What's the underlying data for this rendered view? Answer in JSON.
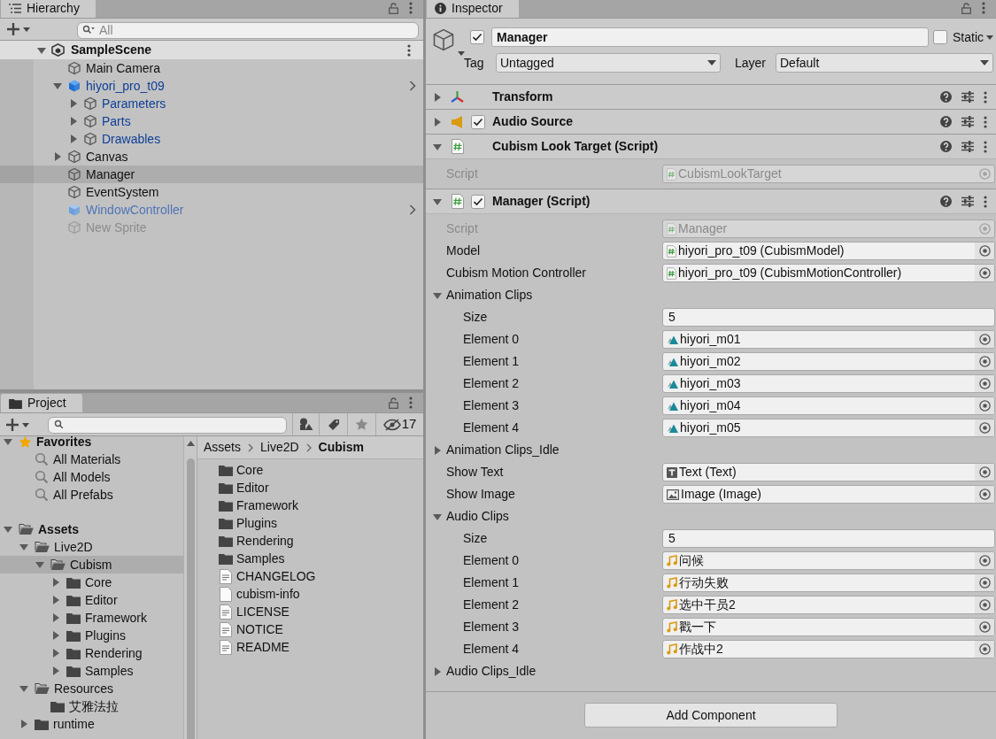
{
  "hierarchy": {
    "title": "Hierarchy",
    "search_placeholder": "All",
    "scene": {
      "name": "SampleScene",
      "expanded": true
    },
    "items": [
      {
        "name": "Main Camera",
        "kind": "object",
        "dimmed": false,
        "selected": false
      },
      {
        "name": "hiyori_pro_t09",
        "kind": "prefab",
        "dimmed": false,
        "selected": false,
        "expanded": true,
        "children": [
          {
            "name": "Parameters",
            "kind": "prefab-part",
            "dimmed": false,
            "selected": false,
            "expanded": false
          },
          {
            "name": "Parts",
            "kind": "prefab-part",
            "dimmed": false,
            "selected": false,
            "expanded": false
          },
          {
            "name": "Drawables",
            "kind": "prefab-part",
            "dimmed": false,
            "selected": false,
            "expanded": false
          }
        ]
      },
      {
        "name": "Canvas",
        "kind": "object",
        "dimmed": false,
        "selected": false,
        "expanded": false
      },
      {
        "name": "Manager",
        "kind": "object",
        "dimmed": false,
        "selected": true
      },
      {
        "name": "EventSystem",
        "kind": "object",
        "dimmed": false,
        "selected": false
      },
      {
        "name": "WindowController",
        "kind": "prefab",
        "dimmed": true,
        "selected": false
      },
      {
        "name": "New Sprite",
        "kind": "object",
        "dimmed": true,
        "selected": false
      }
    ]
  },
  "project": {
    "title": "Project",
    "hidden_count": "17",
    "favorites": {
      "label": "Favorites",
      "expanded": true,
      "items": [
        {
          "label": "All Materials"
        },
        {
          "label": "All Models"
        },
        {
          "label": "All Prefabs"
        }
      ]
    },
    "tree": [
      {
        "label": "Assets",
        "expanded": true,
        "selected": false,
        "children": [
          {
            "label": "Live2D",
            "expanded": true,
            "selected": false,
            "children": [
              {
                "label": "Cubism",
                "expanded": true,
                "selected": true,
                "children": [
                  {
                    "label": "Core",
                    "expanded": false,
                    "selected": false
                  },
                  {
                    "label": "Editor",
                    "expanded": false,
                    "selected": false
                  },
                  {
                    "label": "Framework",
                    "expanded": false,
                    "selected": false
                  },
                  {
                    "label": "Plugins",
                    "expanded": false,
                    "selected": false
                  },
                  {
                    "label": "Rendering",
                    "expanded": false,
                    "selected": false
                  },
                  {
                    "label": "Samples",
                    "expanded": false,
                    "selected": false
                  }
                ]
              }
            ]
          },
          {
            "label": "Resources",
            "expanded": true,
            "selected": false,
            "children": [
              {
                "label": "艾雅法拉",
                "selected": false
              }
            ]
          },
          {
            "label": "runtime",
            "expanded": false,
            "selected": false
          }
        ]
      }
    ],
    "breadcrumb": [
      "Assets",
      "Live2D",
      "Cubism"
    ],
    "files": [
      {
        "name": "Core",
        "kind": "folder"
      },
      {
        "name": "Editor",
        "kind": "folder"
      },
      {
        "name": "Framework",
        "kind": "folder"
      },
      {
        "name": "Plugins",
        "kind": "folder"
      },
      {
        "name": "Rendering",
        "kind": "folder"
      },
      {
        "name": "Samples",
        "kind": "folder"
      },
      {
        "name": "CHANGELOG",
        "kind": "text"
      },
      {
        "name": "cubism-info",
        "kind": "blank"
      },
      {
        "name": "LICENSE",
        "kind": "text"
      },
      {
        "name": "NOTICE",
        "kind": "text"
      },
      {
        "name": "README",
        "kind": "text"
      }
    ]
  },
  "inspector": {
    "title": "Inspector",
    "object": {
      "active": true,
      "name": "Manager",
      "static": false,
      "static_label": "Static",
      "tag_label": "Tag",
      "tag": "Untagged",
      "layer_label": "Layer",
      "layer": "Default"
    },
    "components": [
      {
        "name": "Transform",
        "kind": "transform",
        "expanded": false
      },
      {
        "name": "Audio Source",
        "kind": "audio",
        "expanded": false,
        "enabled": true
      },
      {
        "name": "Cubism Look Target (Script)",
        "kind": "script",
        "expanded": true,
        "properties": [
          {
            "kind": "script",
            "label": "Script",
            "value": "CubismLookTarget",
            "disabled": true
          }
        ]
      },
      {
        "name": "Manager (Script)",
        "kind": "script",
        "expanded": true,
        "enabled": true,
        "properties": [
          {
            "kind": "script",
            "label": "Script",
            "value": "Manager",
            "disabled": true
          },
          {
            "kind": "script",
            "label": "Model",
            "value": "hiyori_pro_t09 (CubismModel)",
            "disabled": false
          },
          {
            "kind": "script",
            "label": "Cubism Motion Controller",
            "value": "hiyori_pro_t09 (CubismMotionController)",
            "disabled": false
          },
          {
            "kind": "array",
            "label": "Animation Clips",
            "expanded": true,
            "size_label": "Size",
            "size": "5",
            "elements": [
              {
                "label": "Element 0",
                "value": "hiyori_m01",
                "kind": "animation"
              },
              {
                "label": "Element 1",
                "value": "hiyori_m02",
                "kind": "animation"
              },
              {
                "label": "Element 2",
                "value": "hiyori_m03",
                "kind": "animation"
              },
              {
                "label": "Element 3",
                "value": "hiyori_m04",
                "kind": "animation"
              },
              {
                "label": "Element 4",
                "value": "hiyori_m05",
                "kind": "animation"
              }
            ]
          },
          {
            "kind": "array",
            "label": "Animation Clips_Idle",
            "expanded": false
          },
          {
            "kind": "text",
            "label": "Show Text",
            "value": "Text (Text)",
            "disabled": false
          },
          {
            "kind": "image",
            "label": "Show Image",
            "value": "Image (Image)",
            "disabled": false
          },
          {
            "kind": "array",
            "label": "Audio Clips",
            "expanded": true,
            "size_label": "Size",
            "size": "5",
            "elements": [
              {
                "label": "Element 0",
                "value": "问候",
                "kind": "audio"
              },
              {
                "label": "Element 1",
                "value": "行动失败",
                "kind": "audio"
              },
              {
                "label": "Element 2",
                "value": "选中干员2",
                "kind": "audio"
              },
              {
                "label": "Element 3",
                "value": "戳一下",
                "kind": "audio"
              },
              {
                "label": "Element 4",
                "value": "作战中2",
                "kind": "audio"
              }
            ]
          },
          {
            "kind": "array",
            "label": "Audio Clips_Idle",
            "expanded": false
          }
        ]
      }
    ],
    "add_component": "Add Component"
  }
}
